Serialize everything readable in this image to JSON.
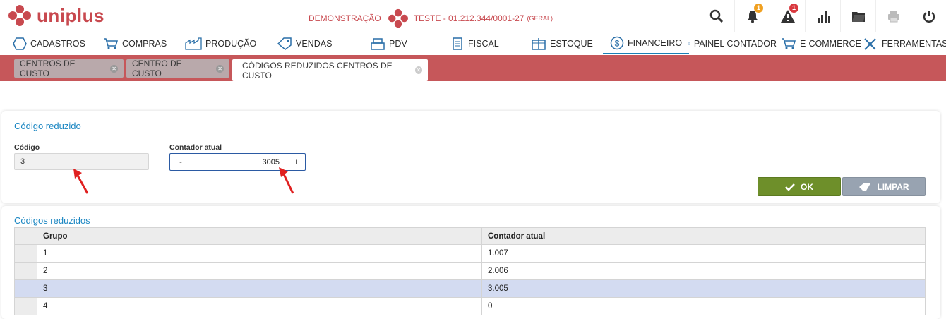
{
  "brand": {
    "name": "uniplus",
    "color": "#c8494f"
  },
  "header": {
    "mode_label": "DEMONSTRAÇÃO",
    "company": "TESTE - 01.212.344/0001-27",
    "company_scope": "(GERAL)",
    "icons": [
      {
        "name": "search-icon"
      },
      {
        "name": "bell-icon",
        "badge": "1",
        "badge_color": "#f0a020"
      },
      {
        "name": "alert-icon",
        "badge": "1",
        "badge_color": "#d9383e"
      },
      {
        "name": "chart-icon"
      },
      {
        "name": "folder-icon"
      },
      {
        "name": "print-icon"
      },
      {
        "name": "power-icon"
      }
    ]
  },
  "nav": {
    "items": [
      {
        "label": "CADASTROS",
        "icon": "hexagon-icon"
      },
      {
        "label": "COMPRAS",
        "icon": "cart-icon"
      },
      {
        "label": "PRODUÇÃO",
        "icon": "factory-icon"
      },
      {
        "label": "VENDAS",
        "icon": "tag-icon"
      },
      {
        "label": "PDV",
        "icon": "register-icon"
      },
      {
        "label": "FISCAL",
        "icon": "document-icon"
      },
      {
        "label": "ESTOQUE",
        "icon": "box-icon"
      },
      {
        "label": "FINANCEIRO",
        "icon": "dollar-icon",
        "active": true
      },
      {
        "label": "PAINEL CONTADOR",
        "icon": "panel-icon"
      },
      {
        "label": "E-COMMERCE",
        "icon": "cart-icon"
      },
      {
        "label": "FERRAMENTAS",
        "icon": "tools-icon"
      }
    ]
  },
  "tabs": [
    {
      "label": "CENTROS DE CUSTO"
    },
    {
      "label": "CENTRO DE CUSTO"
    },
    {
      "label": "CÓDIGOS REDUZIDOS CENTROS DE CUSTO",
      "active": true
    }
  ],
  "form": {
    "section_title": "Código reduzido",
    "codigo_label": "Código",
    "codigo_value": "3",
    "contador_label": "Contador atual",
    "contador_minus": "-",
    "contador_value": "3005",
    "contador_plus": "+",
    "ok_label": "OK",
    "clear_label": "LIMPAR"
  },
  "list": {
    "section_title": "Códigos reduzidos",
    "columns": [
      "Grupo",
      "Contador atual"
    ],
    "rows": [
      {
        "grupo": "1",
        "contador": "1.007"
      },
      {
        "grupo": "2",
        "contador": "2.006"
      },
      {
        "grupo": "3",
        "contador": "3.005",
        "selected": true
      },
      {
        "grupo": "4",
        "contador": "0"
      }
    ]
  }
}
